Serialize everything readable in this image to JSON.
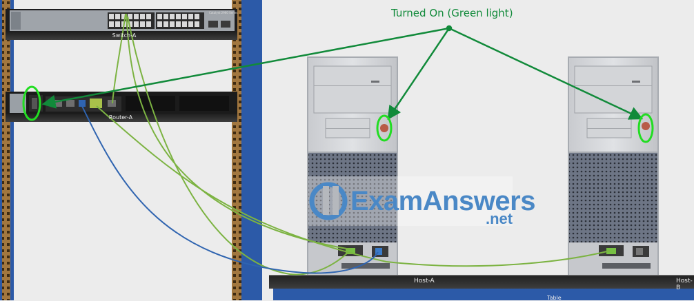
{
  "annotation": {
    "text": "Turned On (Green light)"
  },
  "devices": {
    "switch_name": "Switch-A",
    "switch_brand": "Catalyst 2960 Series",
    "router_name": "Router-A",
    "host_a_name": "Host-A",
    "host_b_name": "Host-B",
    "table_name": "Table"
  },
  "watermark": {
    "main": "ExamAnswers",
    "suffix": ".net"
  },
  "colors": {
    "annotation": "#118a3a",
    "highlight_circle": "#22dd22",
    "copper_cable": "#7cb342",
    "console_cable": "#2f64b0",
    "rack_border": "#2c5aa8"
  }
}
